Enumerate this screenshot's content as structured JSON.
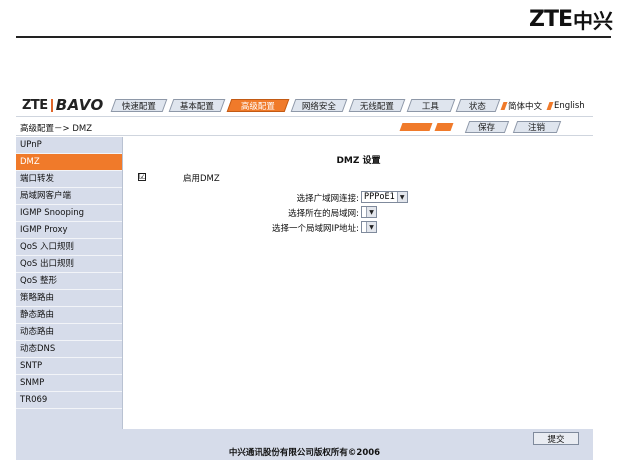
{
  "brand": {
    "latin": "ZTE",
    "chinese": "中兴"
  },
  "app_logo": {
    "left": "ZTE",
    "right": "BAVO"
  },
  "tabs": [
    {
      "label": "快速配置",
      "active": false
    },
    {
      "label": "基本配置",
      "active": false
    },
    {
      "label": "高级配置",
      "active": true
    },
    {
      "label": "网络安全",
      "active": false
    },
    {
      "label": "无线配置",
      "active": false
    },
    {
      "label": "工具",
      "active": false
    },
    {
      "label": "状态",
      "active": false
    }
  ],
  "languages": {
    "chinese": "简体中文",
    "english": "English"
  },
  "breadcrumb": "高级配置－> DMZ",
  "top_buttons": {
    "save": "保存",
    "logout": "注销"
  },
  "sidebar": {
    "items": [
      {
        "label": "UPnP"
      },
      {
        "label": "DMZ",
        "active": true
      },
      {
        "label": "端口转发"
      },
      {
        "label": "局域网客户端"
      },
      {
        "label": "IGMP Snooping"
      },
      {
        "label": "IGMP Proxy"
      },
      {
        "label": "QoS 入口规则"
      },
      {
        "label": "QoS 出口规则"
      },
      {
        "label": "QoS 整形"
      },
      {
        "label": "策略路由"
      },
      {
        "label": "静态路由"
      },
      {
        "label": "动态路由"
      },
      {
        "label": "动态DNS"
      },
      {
        "label": "SNTP"
      },
      {
        "label": "SNMP"
      },
      {
        "label": "TR069"
      }
    ]
  },
  "main": {
    "title": "DMZ 设置",
    "enable_dmz": {
      "label": "启用DMZ",
      "checked": true,
      "mark": "☑"
    },
    "fields": [
      {
        "label": "选择广域网连接:",
        "value": "PPPoE1"
      },
      {
        "label": "选择所在的局域网:",
        "value": ""
      },
      {
        "label": "选择一个局域网IP地址:",
        "value": ""
      }
    ]
  },
  "submit_label": "提交",
  "copyright": "中兴通讯股份有限公司版权所有©2006",
  "colors": {
    "accent": "#f07a2a",
    "sidebar_bg": "#d6dcea",
    "tab_bg": "#dfe5ee"
  }
}
